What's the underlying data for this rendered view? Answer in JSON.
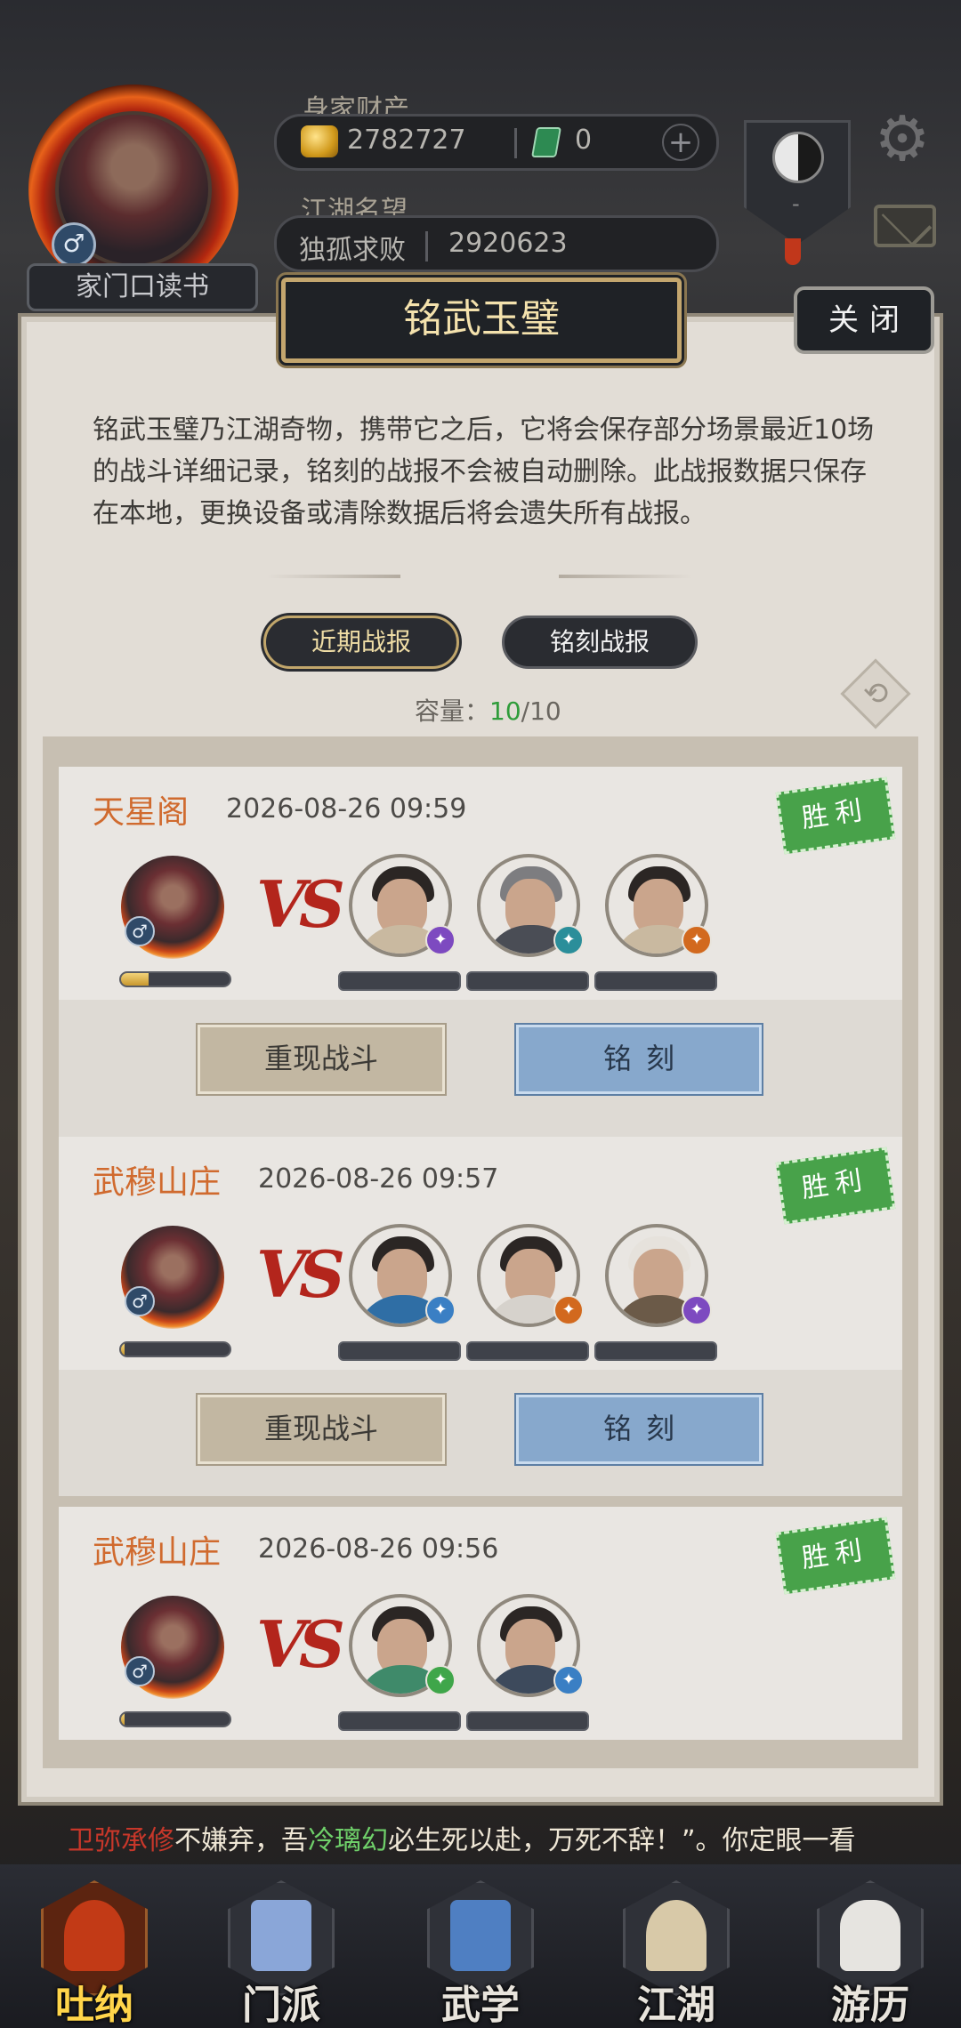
{
  "header": {
    "home_book": "家门口读书",
    "gender_symbol": "♂",
    "wealth_label": "身家财产",
    "silver": "2782727",
    "jade": "0",
    "plus": "+",
    "fame_label": "江湖名望",
    "fame_title": "独孤求败",
    "fame_value": "2920623",
    "sect_dash": "-",
    "gear_glyph": "⚙"
  },
  "panel": {
    "title": "铭武玉璧",
    "close": "关闭",
    "description": "铭武玉璧乃江湖奇物，携带它之后，它将会保存部分场景最近10场的战斗详细记录，铭刻的战报不会被自动删除。此战报数据只保存在本地，更换设备或清除数据后将会遗失所有战报。",
    "tabs": {
      "recent": "近期战报",
      "engraved": "铭刻战报"
    },
    "capacity_label": "容量：",
    "capacity_used": "10",
    "capacity_total": "/10",
    "refresh_glyph": "⟲"
  },
  "battles": [
    {
      "location": "天星阁",
      "time": "2026-08-26 09:59",
      "result": "胜利",
      "vs": "VS",
      "player_progress": 0.25,
      "enemies": [
        {
          "element": "purple",
          "glyph": "✦"
        },
        {
          "element": "teal",
          "glyph": "✦"
        },
        {
          "element": "orange",
          "glyph": "✦"
        }
      ],
      "replay": "重现战斗",
      "engrave": "铭刻"
    },
    {
      "location": "武穆山庄",
      "time": "2026-08-26 09:57",
      "result": "胜利",
      "vs": "VS",
      "player_progress": 0.03,
      "enemies": [
        {
          "element": "blue",
          "glyph": "✦"
        },
        {
          "element": "orange",
          "glyph": "✦"
        },
        {
          "element": "purple",
          "glyph": "✦"
        }
      ],
      "replay": "重现战斗",
      "engrave": "铭刻"
    },
    {
      "location": "武穆山庄",
      "time": "2026-08-26 09:56",
      "result": "胜利",
      "vs": "VS",
      "player_progress": 0.03,
      "enemies": [
        {
          "element": "green",
          "glyph": "✦"
        },
        {
          "element": "blue",
          "glyph": "✦"
        }
      ]
    }
  ],
  "story": {
    "name1": "卫弥承修",
    "text1": "不嫌弃，吾",
    "name2": "冷璃幻",
    "text2": "必生死以赴，万死不辞！”。你定眼一看"
  },
  "nav": [
    {
      "label": "吐纳",
      "active": true
    },
    {
      "label": "门派",
      "active": false
    },
    {
      "label": "武学",
      "active": false
    },
    {
      "label": "江湖",
      "active": false
    },
    {
      "label": "游历",
      "active": false
    }
  ],
  "colors": {
    "accent_orange": "#d06a2e",
    "win_green": "#48a24a",
    "engrave_blue": "#87a8cc",
    "capacity_green": "#2f9c3a"
  }
}
